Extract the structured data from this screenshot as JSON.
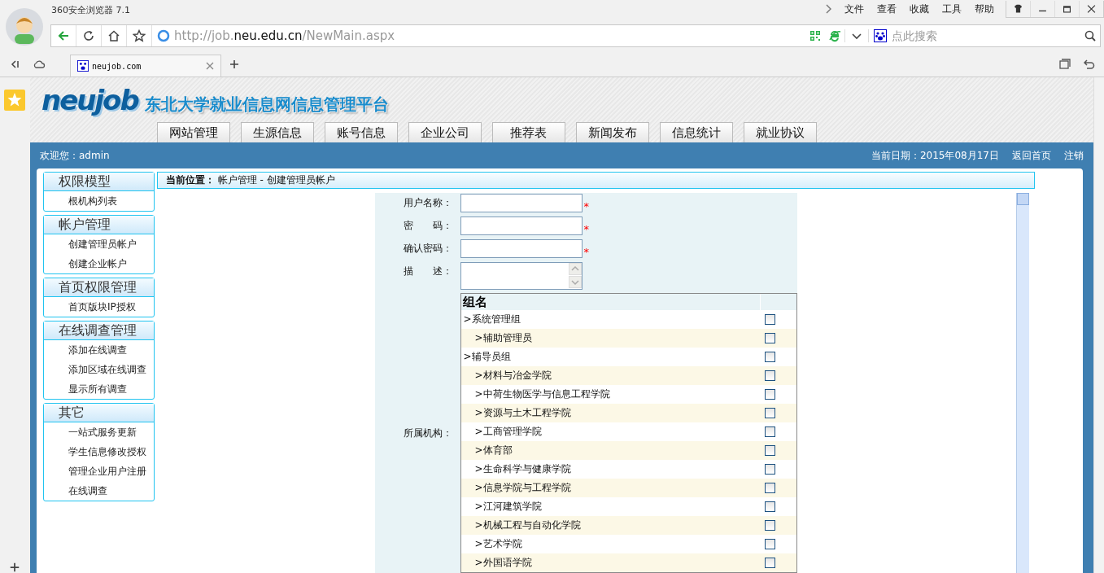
{
  "browser": {
    "title": "360安全浏览器 7.1",
    "menu": [
      "文件",
      "查看",
      "收藏",
      "工具",
      "帮助"
    ],
    "url": {
      "scheme": "http://job.",
      "host": "neu.edu.cn",
      "path": "/NewMain.aspx"
    },
    "search": {
      "placeholder": "点此搜索"
    },
    "tab": {
      "title": "neujob.com",
      "selected": true
    }
  },
  "site": {
    "logo": "neujob",
    "title": "东北大学就业信息网信息管理平台",
    "nav": [
      "网站管理",
      "生源信息",
      "账号信息",
      "企业公司",
      "推荐表",
      "新闻发布",
      "信息统计",
      "就业协议"
    ],
    "welcome": "欢迎您：admin",
    "date": "当前日期：2015年08月17日",
    "links": [
      "返回首页",
      "注销"
    ]
  },
  "sidebar": [
    {
      "title": "权限模型",
      "items": [
        "根机构列表"
      ]
    },
    {
      "title": "帐户管理",
      "items": [
        "创建管理员帐户",
        "创建企业帐户"
      ]
    },
    {
      "title": "首页权限管理",
      "items": [
        "首页版块IP授权"
      ]
    },
    {
      "title": "在线调查管理",
      "items": [
        "添加在线调查",
        "添加区域在线调查",
        "显示所有调查"
      ]
    },
    {
      "title": "其它",
      "items": [
        "一站式服务更新",
        "学生信息修改授权",
        "管理企业用户注册",
        "在线调查"
      ]
    }
  ],
  "breadcrumb": {
    "label": "当前位置：",
    "path": "帐户管理 -  创建管理员帐户"
  },
  "form": {
    "fields": [
      {
        "label": "用户名称：",
        "kind": "text",
        "mark": "*"
      },
      {
        "label": "密　　码：",
        "kind": "password",
        "mark": "*"
      },
      {
        "label": "确认密码：",
        "kind": "password",
        "mark": "*"
      },
      {
        "label": "描　　述：",
        "kind": "textarea"
      }
    ],
    "groups_label": "所属机构：",
    "groups_header": "组名",
    "groups": [
      {
        "name": ">系统管理组",
        "checked": false,
        "children": [
          {
            "name": ">辅助管理员",
            "checked": false
          }
        ]
      },
      {
        "name": ">辅导员组",
        "checked": false,
        "children": [
          {
            "name": ">材料与冶金学院",
            "checked": false
          },
          {
            "name": ">中荷生物医学与信息工程学院",
            "checked": false
          },
          {
            "name": ">资源与土木工程学院",
            "checked": false
          },
          {
            "name": ">工商管理学院",
            "checked": false
          },
          {
            "name": ">体育部",
            "checked": false
          },
          {
            "name": ">生命科学与健康学院",
            "checked": false
          },
          {
            "name": ">信息学院与工程学院",
            "checked": false
          },
          {
            "name": ">江河建筑学院",
            "checked": false
          },
          {
            "name": ">机械工程与自动化学院",
            "checked": false
          },
          {
            "name": ">艺术学院",
            "checked": false
          },
          {
            "name": ">外国语学院",
            "checked": false
          }
        ]
      }
    ]
  }
}
